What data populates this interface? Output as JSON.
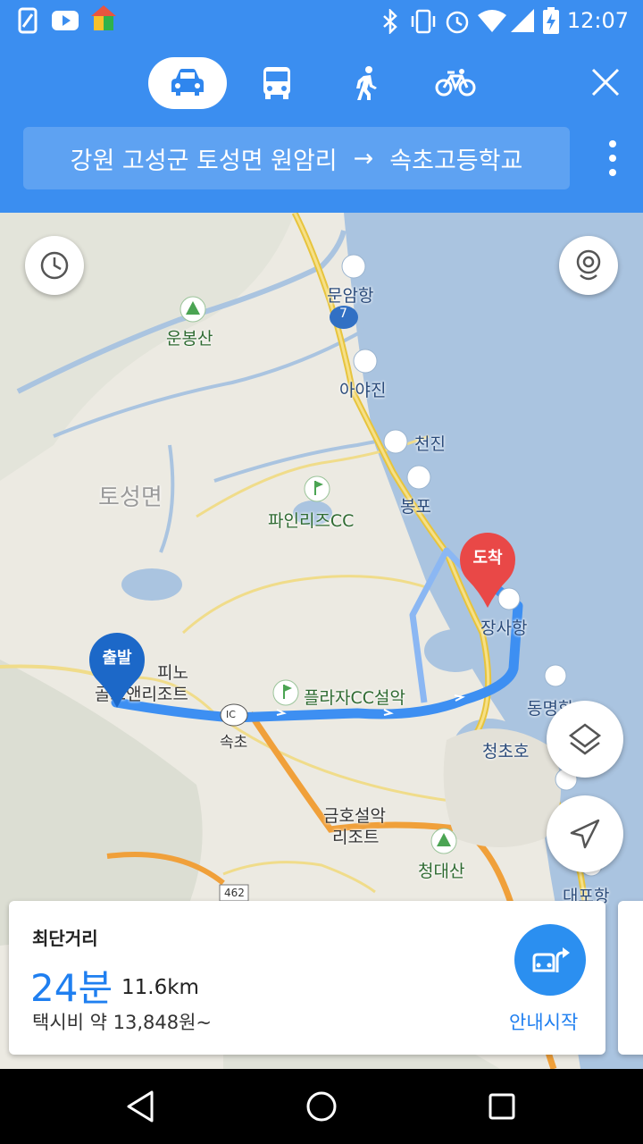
{
  "status_bar": {
    "time": "12:07",
    "left_icons": [
      "notification-icon",
      "youtube-icon",
      "home-app-icon"
    ],
    "right_icons": [
      "bluetooth-icon",
      "vibrate-icon",
      "alarm-icon",
      "wifi-icon",
      "cell-signal-icon",
      "battery-charging-icon"
    ]
  },
  "header": {
    "modes": [
      {
        "icon": "car-icon",
        "active": true
      },
      {
        "icon": "bus-icon",
        "active": false
      },
      {
        "icon": "walk-icon",
        "active": false
      },
      {
        "icon": "bike-icon",
        "active": false
      }
    ],
    "route": {
      "origin": "강원 고성군 토성면 원암리",
      "arrow": "→",
      "destination": "속초고등학교"
    }
  },
  "map": {
    "labels": {
      "munamhang": "문암항",
      "road7": "7",
      "unbongsan": "운봉산",
      "ayajin": "아야진",
      "cheonjin": "천진",
      "tosungmyeon": "토성면",
      "bongpo": "봉포",
      "pinerizcc": "파인리즈CC",
      "jangsahang": "장사항",
      "pino_line1": "피노",
      "pino_line2": "골프앤리조트",
      "plaza": "플라자CC설악",
      "ic": "IC",
      "sokcho": "속초",
      "dongmyeong": "동명항",
      "cheongchoho": "청초호",
      "geumho_line1": "금호설악",
      "geumho_line2": "리조트",
      "cheongdaesan": "청대산",
      "road462": "462",
      "daepohang": "대포항"
    },
    "start_pin": "출발",
    "end_pin": "도착"
  },
  "route_card": {
    "mode_label": "최단거리",
    "duration": "24분",
    "distance": "11.6km",
    "taxi_fare": "택시비 약 13,848원~",
    "start_label": "안내시작"
  },
  "colors": {
    "accent": "#3b8ef0",
    "route": "#3d8ff2",
    "start_pin": "#1c68c8",
    "end_pin": "#e94847",
    "sea": "#a9c3df"
  }
}
